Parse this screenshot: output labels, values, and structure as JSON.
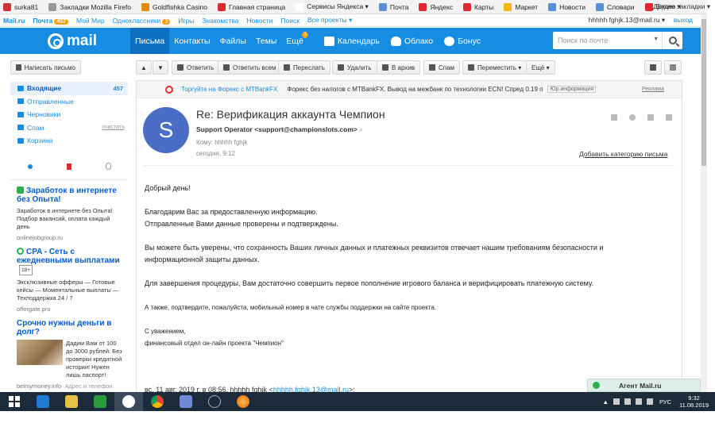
{
  "bookmarks": [
    {
      "label": "surka81",
      "color": "#c33"
    },
    {
      "label": "Закладки Mozilla Firefo",
      "color": "#999"
    },
    {
      "label": "Goldfishka Casino",
      "color": "#e68a00"
    },
    {
      "label": "Главная страница",
      "color": "#e0282e"
    },
    {
      "label": "Сервисы Яндекса ▾",
      "color": "#ffffff"
    },
    {
      "label": "Почта",
      "color": "#5a8ed6"
    },
    {
      "label": "Яндекс",
      "color": "#e0282e"
    },
    {
      "label": "Карты",
      "color": "#e0282e"
    },
    {
      "label": "Маркет",
      "color": "#f5b800"
    },
    {
      "label": "Новости",
      "color": "#5a8ed6"
    },
    {
      "label": "Словари",
      "color": "#5a8ed6"
    },
    {
      "label": "Видео ▾",
      "color": "#e0282e"
    }
  ],
  "bookmarks_right": "Другие закладки ▾",
  "portal": {
    "mailru": "Mail.ru",
    "mail": "Почта",
    "mail_count": "457",
    "moy_mir": "Мой Мир",
    "ok": "Одноклассники",
    "ok_count": "3",
    "games": "Игры",
    "dating": "Знакомства",
    "news": "Новости",
    "search": "Поиск",
    "all_projects": "Все проекты ▾",
    "user": "hhhhh fghjk.13@mail.ru ▾",
    "logout": "выход"
  },
  "header": {
    "logo": "mail",
    "nav": [
      "Письма",
      "Контакты",
      "Файлы",
      "Темы",
      "Ещё"
    ],
    "more_badge": "3",
    "calendar": "Календарь",
    "cloud": "Облако",
    "bonus": "Бонус",
    "search_placeholder": "Поиск по почте"
  },
  "toolbar": {
    "compose": "Написать письмо",
    "reply": "Ответить",
    "reply_all": "Ответить всем",
    "forward": "Переслать",
    "delete": "Удалить",
    "archive": "В архив",
    "spam": "Спам",
    "move": "Переместить ▾",
    "more": "Ещё ▾"
  },
  "folders": {
    "inbox": "Входящие",
    "inbox_count": "457",
    "sent": "Отправленные",
    "drafts": "Черновики",
    "spam": "Спам",
    "spam_clear": "очистить",
    "trash": "Корзина"
  },
  "ads": [
    {
      "title": "Заработок в интернете без Опыта!",
      "text": "Заработок в интернете без Опыта! Подбор вакансий, оплата каждый день",
      "source": "onlinejobgroup.ru"
    },
    {
      "title": "CPA - Сеть с ежедневными выплатами",
      "badge": "18+",
      "text": "Эксклюзивные офферы — Готовые кейсы — Моментальные выплаты — Техподдержка 24 / 7",
      "source": "offergate.pro"
    },
    {
      "title": "Срочно нужны деньги в долг?",
      "text": "Дадим Вам от 100 до 3000 рублей. Без проверки кредитной истории! Нужен лишь паспорт!",
      "source": "belmymoney.info",
      "source_extra": "Адрес и телефон"
    }
  ],
  "adline": {
    "text1": "Торгуйте на Форекс с MTBankFX",
    "text2": "Форекс без налогов с MTBankFX. Вывод на межбанк по технологии ECN! Спред 0.19 п",
    "tag": "Юр.информация",
    "reklama": "Реклама"
  },
  "message": {
    "avatar_letter": "S",
    "subject": "Re: Верификация аккаунта Чемпион",
    "from": "Support Operator <support@championslots.com>",
    "to": "Кому: hhhhh fghjk",
    "date": "сегодня, 9:12",
    "add_category": "Добавить категорию письма",
    "body": [
      "Добрый день!",
      "Благодарим Вас за предоставленную информацию.",
      "Отправленные Вами данные проверены и подтверждены.",
      "Вы можете быть уверены, что сохранность Ваших личных данных и платежных реквизитов отвечает нашим требованиям безопасности и информационной защиты данных.",
      "Для завершения процедуры, Вам достаточно совершить первое пополнение игрового баланса и верифицировать платежную систему.",
      "А также, подтвердите, пожалуйста, мобильный номер в чате службы поддержки на сайте проекта.",
      "С уважением,",
      "финансовый отдел он-лайн проекта \"Чемпион\""
    ],
    "quote_prefix": "вс, 11 авг. 2019 г. в 08:56, hhhhh fghjk <",
    "quote_email": "hhhhh.fghjk.13@mail.ru",
    "quote_suffix": ">:"
  },
  "agent": "Агент Mail.ru",
  "taskbar": {
    "lang": "РУС",
    "time": "9:32",
    "date": "11.08.2019"
  }
}
